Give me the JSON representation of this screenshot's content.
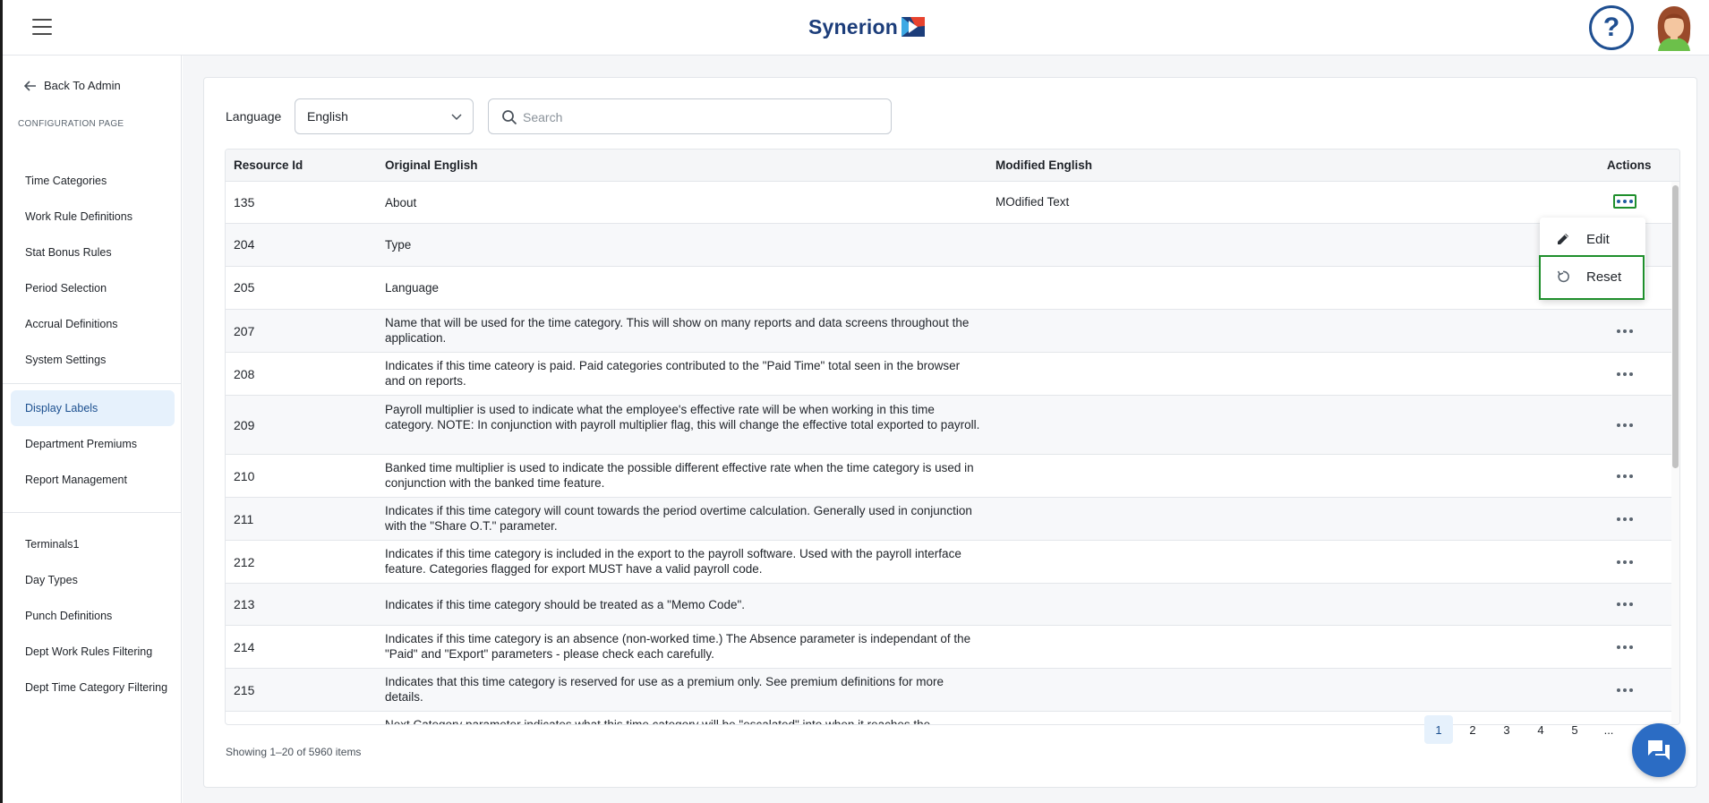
{
  "header": {
    "brand": "Synerion",
    "help_glyph": "?",
    "icons": [
      "hamburger-menu-icon",
      "help-icon",
      "user-avatar"
    ]
  },
  "sidebar": {
    "back_label": "Back To Admin",
    "section_caption": "CONFIGURATION PAGE",
    "group1": [
      {
        "label": "Time Categories"
      },
      {
        "label": "Work Rule Definitions"
      },
      {
        "label": "Stat Bonus Rules"
      },
      {
        "label": "Period Selection"
      },
      {
        "label": "Accrual Definitions"
      },
      {
        "label": "System Settings"
      }
    ],
    "group2": [
      {
        "label": "Display Labels",
        "active": true
      },
      {
        "label": "Department Premiums"
      },
      {
        "label": "Report Management"
      }
    ],
    "group3": [
      {
        "label": "Terminals1"
      },
      {
        "label": "Day Types"
      },
      {
        "label": "Punch Definitions"
      },
      {
        "label": "Dept Work Rules Filtering"
      },
      {
        "label": "Dept Time Category Filtering"
      }
    ]
  },
  "filters": {
    "language_label": "Language",
    "language_value": "English",
    "search_placeholder": "Search",
    "search_value": ""
  },
  "table": {
    "columns": {
      "id": "Resource Id",
      "original": "Original English",
      "modified": "Modified English",
      "actions": "Actions"
    },
    "rows": [
      {
        "id": "135",
        "original": "About",
        "modified": "MOdified Text"
      },
      {
        "id": "204",
        "original": "Type",
        "modified": ""
      },
      {
        "id": "205",
        "original": "Language",
        "modified": ""
      },
      {
        "id": "207",
        "original": "Name that will be used for the time category. This will show on many reports and data screens throughout the application.",
        "modified": ""
      },
      {
        "id": "208",
        "original": "Indicates if this time cateory is paid. Paid categories contributed to the \"Paid Time\" total seen in the browser and on reports.",
        "modified": ""
      },
      {
        "id": "209",
        "original": "Payroll multiplier is used to indicate what the employee's effective rate will be when working in this time category. NOTE: In conjunction with payroll multiplier flag, this will change the effective total exported to payroll.",
        "modified": ""
      },
      {
        "id": "210",
        "original": "Banked time multiplier is used to indicate the possible different effective rate when the time category is used in conjunction with the banked time feature.",
        "modified": ""
      },
      {
        "id": "211",
        "original": "Indicates if this time category will count towards the period overtime calculation. Generally used in conjunction with the \"Share O.T.\" parameter.",
        "modified": ""
      },
      {
        "id": "212",
        "original": "Indicates if this time category is included in the export to the payroll software. Used with the payroll interface feature. Categories flagged for export MUST have a valid payroll code.",
        "modified": ""
      },
      {
        "id": "213",
        "original": "Indicates if this time category should be treated as a \"Memo Code\".",
        "modified": ""
      },
      {
        "id": "214",
        "original": "Indicates if this time category is an absence (non-worked time.) The Absence parameter is independant of the \"Paid\" and \"Export\" parameters - please check each carefully.",
        "modified": ""
      },
      {
        "id": "215",
        "original": "Indicates that this time category is reserved for use as a premium only. See premium definitions for more details.",
        "modified": ""
      },
      {
        "id": "",
        "original": "Next Category parameter indicates what this time category will be \"escalated\" into when it reaches the",
        "modified": ""
      }
    ]
  },
  "action_menu": {
    "edit_label": "Edit",
    "reset_label": "Reset"
  },
  "footer": {
    "showing": "Showing 1–20 of 5960 items",
    "pages": [
      "1",
      "2",
      "3",
      "4",
      "5",
      "..."
    ],
    "current_page": "1"
  },
  "colors": {
    "brand_blue": "#1c3d7a",
    "accent": "#2b6cc4",
    "active_bg": "#e6f1fc",
    "highlight_green": "#1f8f2c"
  }
}
